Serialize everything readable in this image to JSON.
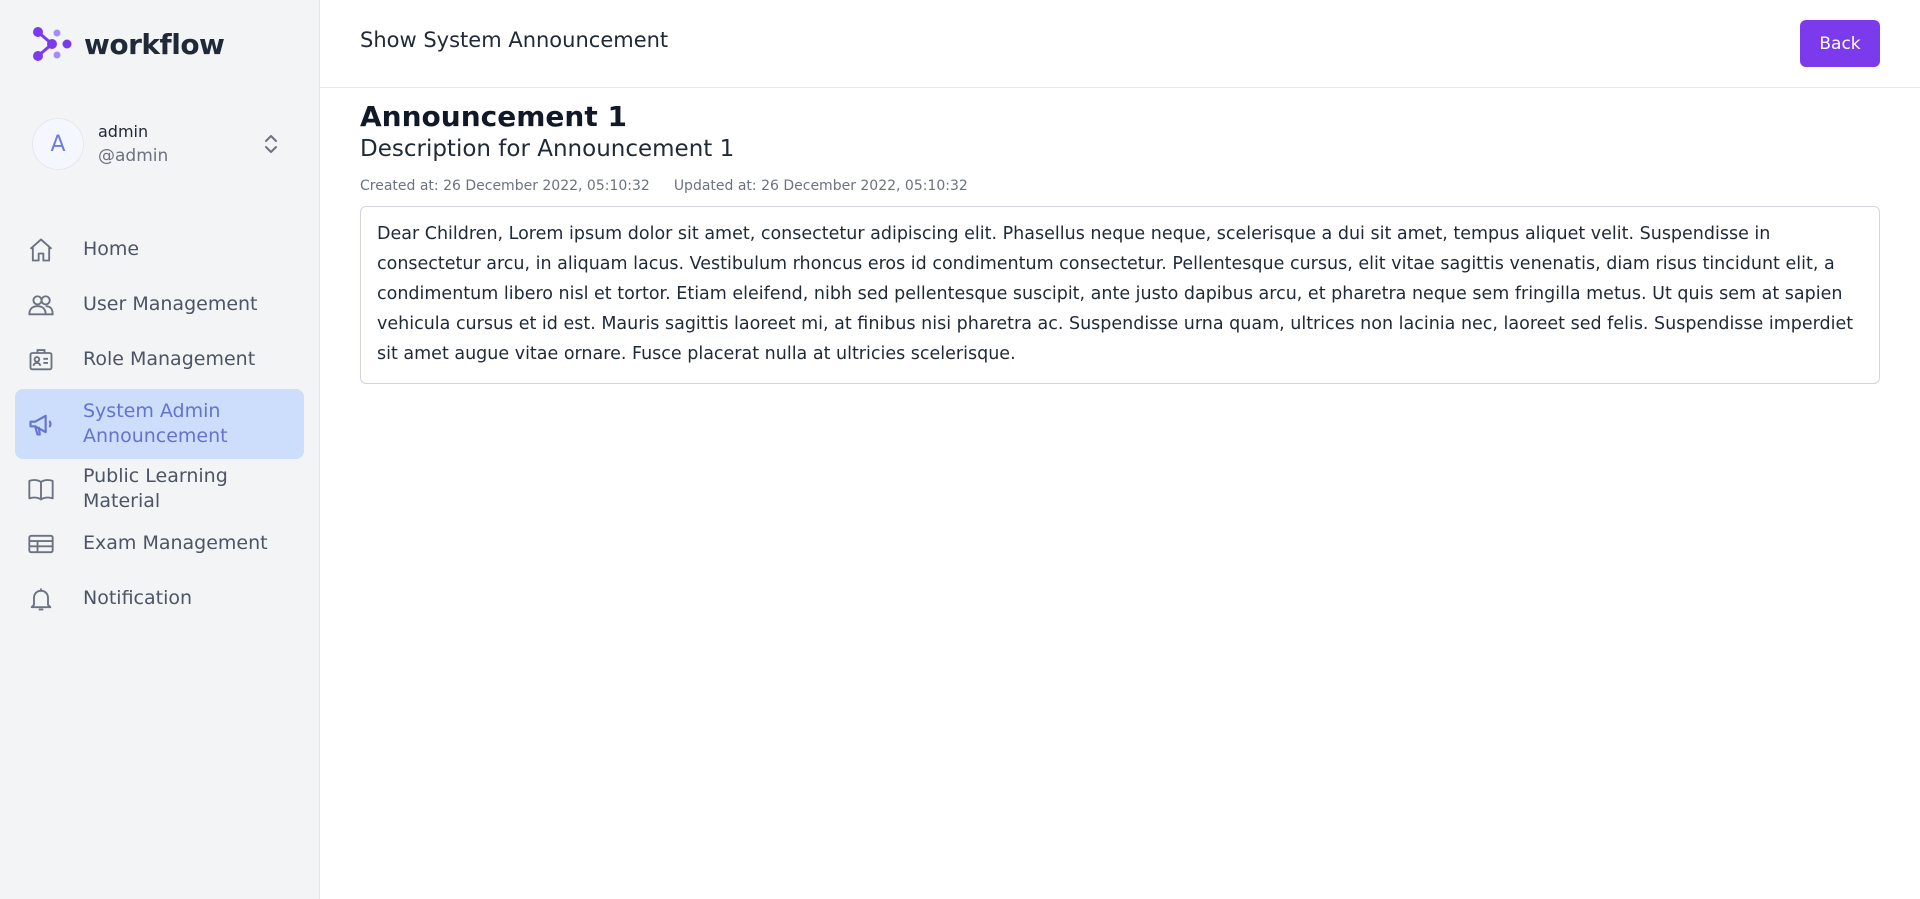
{
  "app": {
    "name": "workflow"
  },
  "user": {
    "initial": "A",
    "name": "admin",
    "handle": "@admin"
  },
  "sidebar": {
    "items": [
      {
        "label": "Home",
        "icon": "home-icon",
        "active": false
      },
      {
        "label": "User Management",
        "icon": "users-icon",
        "active": false
      },
      {
        "label": "Role Management",
        "icon": "id-card-icon",
        "active": false
      },
      {
        "label": "System Admin Announcement",
        "icon": "megaphone-icon",
        "active": true
      },
      {
        "label": "Public Learning Material",
        "icon": "book-icon",
        "active": false
      },
      {
        "label": "Exam Management",
        "icon": "table-icon",
        "active": false
      },
      {
        "label": "Notification",
        "icon": "bell-icon",
        "active": false
      }
    ]
  },
  "header": {
    "title": "Show System Announcement",
    "back_label": "Back"
  },
  "announcement": {
    "title": "Announcement 1",
    "description": "Description for Announcement 1",
    "created": "Created at: 26 December 2022, 05:10:32",
    "updated": "Updated at: 26 December 2022, 05:10:32",
    "body": "Dear Children, Lorem ipsum dolor sit amet, consectetur adipiscing elit. Phasellus neque neque, scelerisque a dui sit amet, tempus aliquet velit. Suspendisse in consectetur arcu, in aliquam lacus. Vestibulum rhoncus eros id condimentum consectetur. Pellentesque cursus, elit vitae sagittis venenatis, diam risus tincidunt elit, a condimentum libero nisl et tortor. Etiam eleifend, nibh sed pellentesque suscipit, ante justo dapibus arcu, et pharetra neque sem fringilla metus. Ut quis sem at sapien vehicula cursus et id est. Mauris sagittis laoreet mi, at finibus nisi pharetra ac. Suspendisse urna quam, ultrices non lacinia nec, laoreet sed felis. Suspendisse imperdiet sit amet augue vitae ornare. Fusce placerat nulla at ultricies scelerisque."
  },
  "colors": {
    "accent": "#7c3aed",
    "active_bg": "#cdddfc",
    "active_text": "#6374cc",
    "sidebar_bg": "#f3f4f6"
  }
}
